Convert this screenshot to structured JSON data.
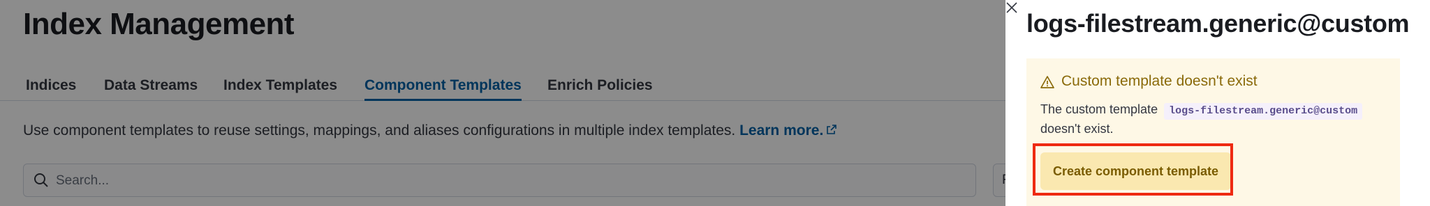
{
  "page": {
    "title": "Index Management",
    "tabs": [
      {
        "label": "Indices"
      },
      {
        "label": "Data Streams"
      },
      {
        "label": "Index Templates"
      },
      {
        "label": "Component Templates",
        "active": true
      },
      {
        "label": "Enrich Policies"
      }
    ],
    "description": "Use component templates to reuse settings, mappings, and aliases configurations in multiple index templates.",
    "learn_more": "Learn more.",
    "search": {
      "placeholder": "Search...",
      "value": ""
    },
    "filter_label": "F"
  },
  "flyout": {
    "title": "logs-filestream.generic@custom",
    "callout": {
      "title": "Custom template doesn't exist",
      "body_prefix": "The custom template",
      "template_name": "logs-filestream.generic@custom",
      "body_suffix": "doesn't exist.",
      "create_button": "Create component template"
    }
  },
  "colors": {
    "primary": "#0061a6",
    "warning_text": "#8a6a0a",
    "warning_bg": "#fef8e6",
    "warning_button_bg": "#fae8b0",
    "highlight": "#ee2a12"
  },
  "icons": [
    "close-icon",
    "search-icon",
    "external-link-icon",
    "warning-icon"
  ]
}
